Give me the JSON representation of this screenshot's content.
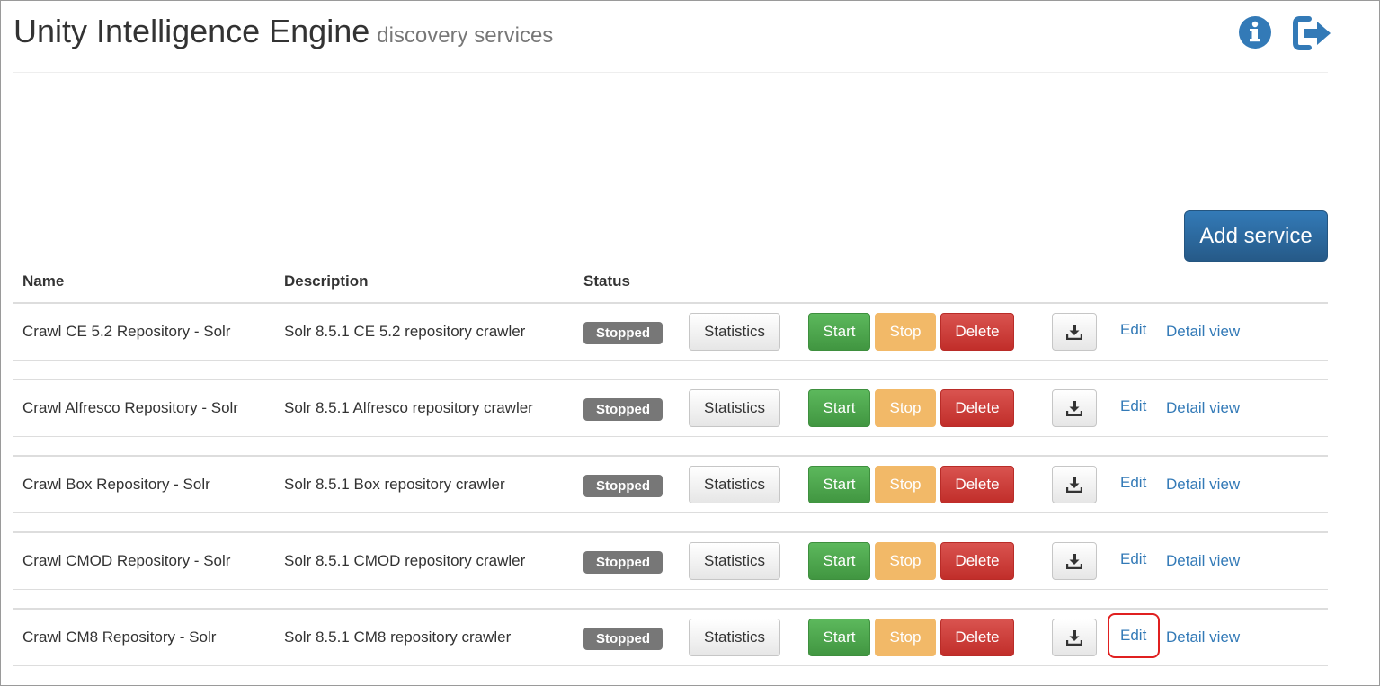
{
  "header": {
    "title": "Unity Intelligence Engine",
    "subtitle": "discovery services",
    "icons": [
      "info-icon",
      "logout-icon"
    ]
  },
  "actions": {
    "add_service_label": "Add service"
  },
  "table": {
    "columns": [
      "Name",
      "Description",
      "Status"
    ],
    "buttons": {
      "statistics": "Statistics",
      "start": "Start",
      "stop": "Stop",
      "delete": "Delete",
      "download_icon": "download-icon",
      "edit": "Edit",
      "detail_view": "Detail view"
    },
    "rows": [
      {
        "name": "Crawl CE 5.2 Repository - Solr",
        "description": "Solr 8.5.1 CE 5.2 repository crawler",
        "status": "Stopped"
      },
      {
        "name": "Crawl Alfresco Repository - Solr",
        "description": "Solr 8.5.1 Alfresco repository crawler",
        "status": "Stopped"
      },
      {
        "name": "Crawl Box Repository - Solr",
        "description": "Solr 8.5.1 Box repository crawler",
        "status": "Stopped"
      },
      {
        "name": "Crawl CMOD Repository - Solr",
        "description": "Solr 8.5.1 CMOD repository crawler",
        "status": "Stopped"
      },
      {
        "name": "Crawl CM8 Repository - Solr",
        "description": "Solr 8.5.1 CM8 repository crawler",
        "status": "Stopped"
      }
    ]
  },
  "colors": {
    "primary": "#337ab7",
    "success": "#5cb85c",
    "warning": "#f0ad4e",
    "danger": "#d9534f",
    "status_badge": "#777777",
    "highlight": "#e02020"
  }
}
